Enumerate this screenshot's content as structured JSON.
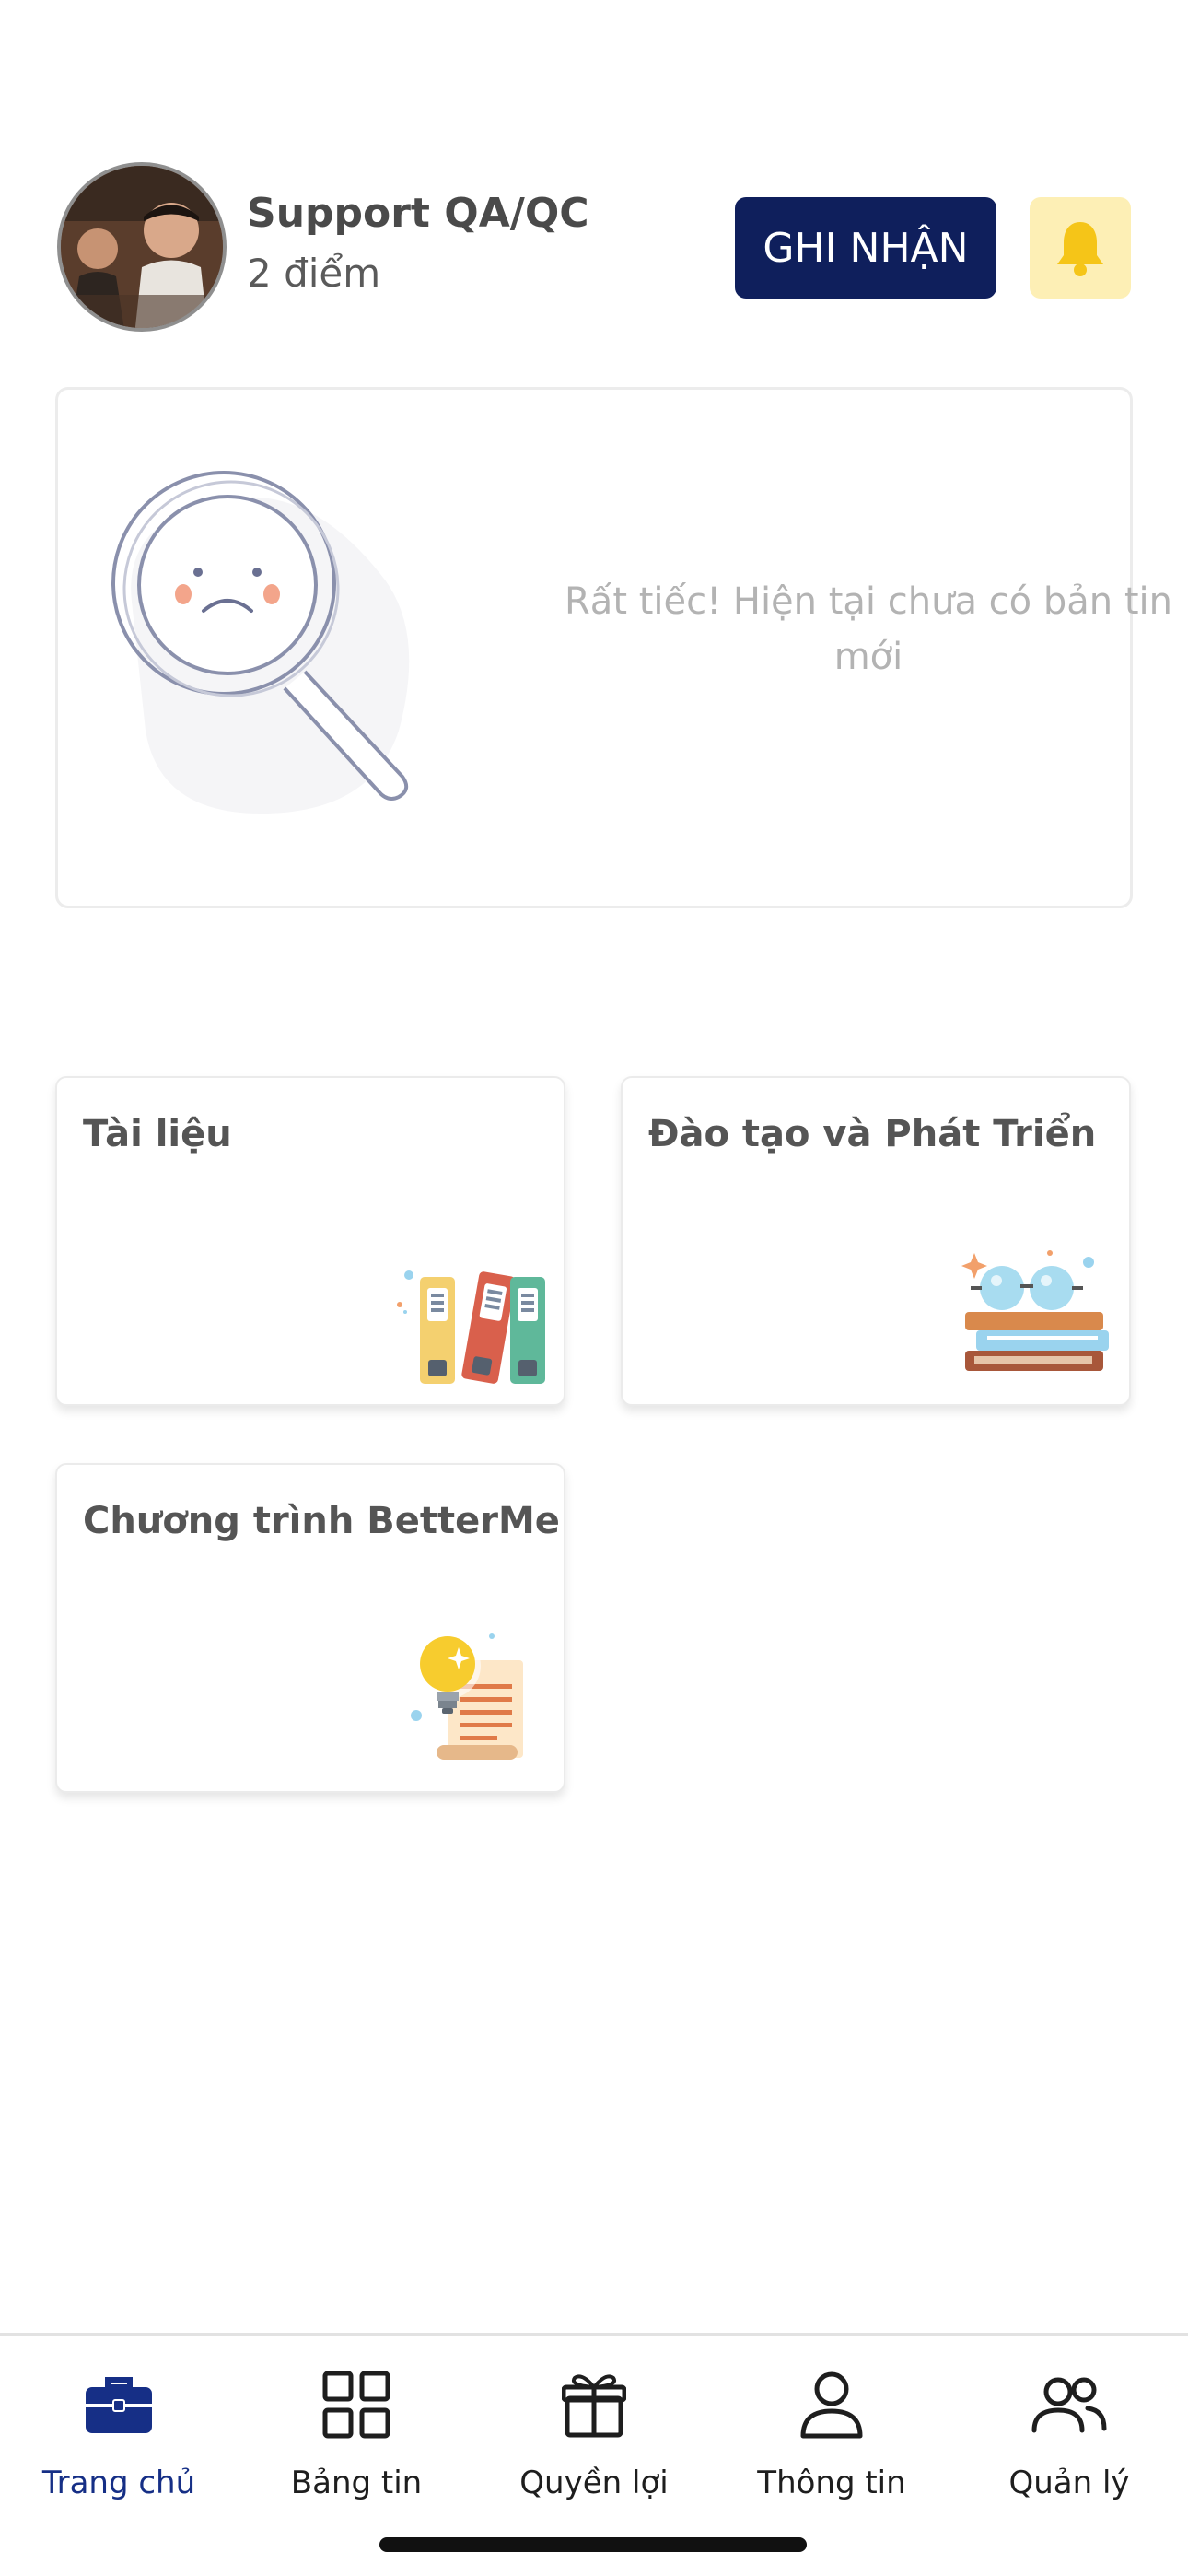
{
  "header": {
    "user_name": "Support QA/QC",
    "points": "2 điểm",
    "action_button": "GHI NHẬN"
  },
  "news": {
    "empty_message": "Rất tiếc! Hiện tại chưa có bản tin mới"
  },
  "tiles": [
    {
      "title": "Tài liệu",
      "icon": "binders-icon"
    },
    {
      "title": "Đào tạo và Phát Triển",
      "icon": "books-glasses-icon"
    },
    {
      "title": "Chương trình BetterMe",
      "icon": "lightbulb-document-icon"
    }
  ],
  "bottom_nav": [
    {
      "label": "Trang chủ",
      "icon": "briefcase-icon",
      "active": true
    },
    {
      "label": "Bảng tin",
      "icon": "grid-icon",
      "active": false
    },
    {
      "label": "Quyền lợi",
      "icon": "gift-icon",
      "active": false
    },
    {
      "label": "Thông tin",
      "icon": "user-icon",
      "active": false
    },
    {
      "label": "Quản lý",
      "icon": "users-icon",
      "active": false
    }
  ],
  "colors": {
    "primary": "#0f1f5c",
    "bell_bg": "#fdefb5",
    "bell": "#f5c518",
    "active_nav": "#162f86"
  }
}
